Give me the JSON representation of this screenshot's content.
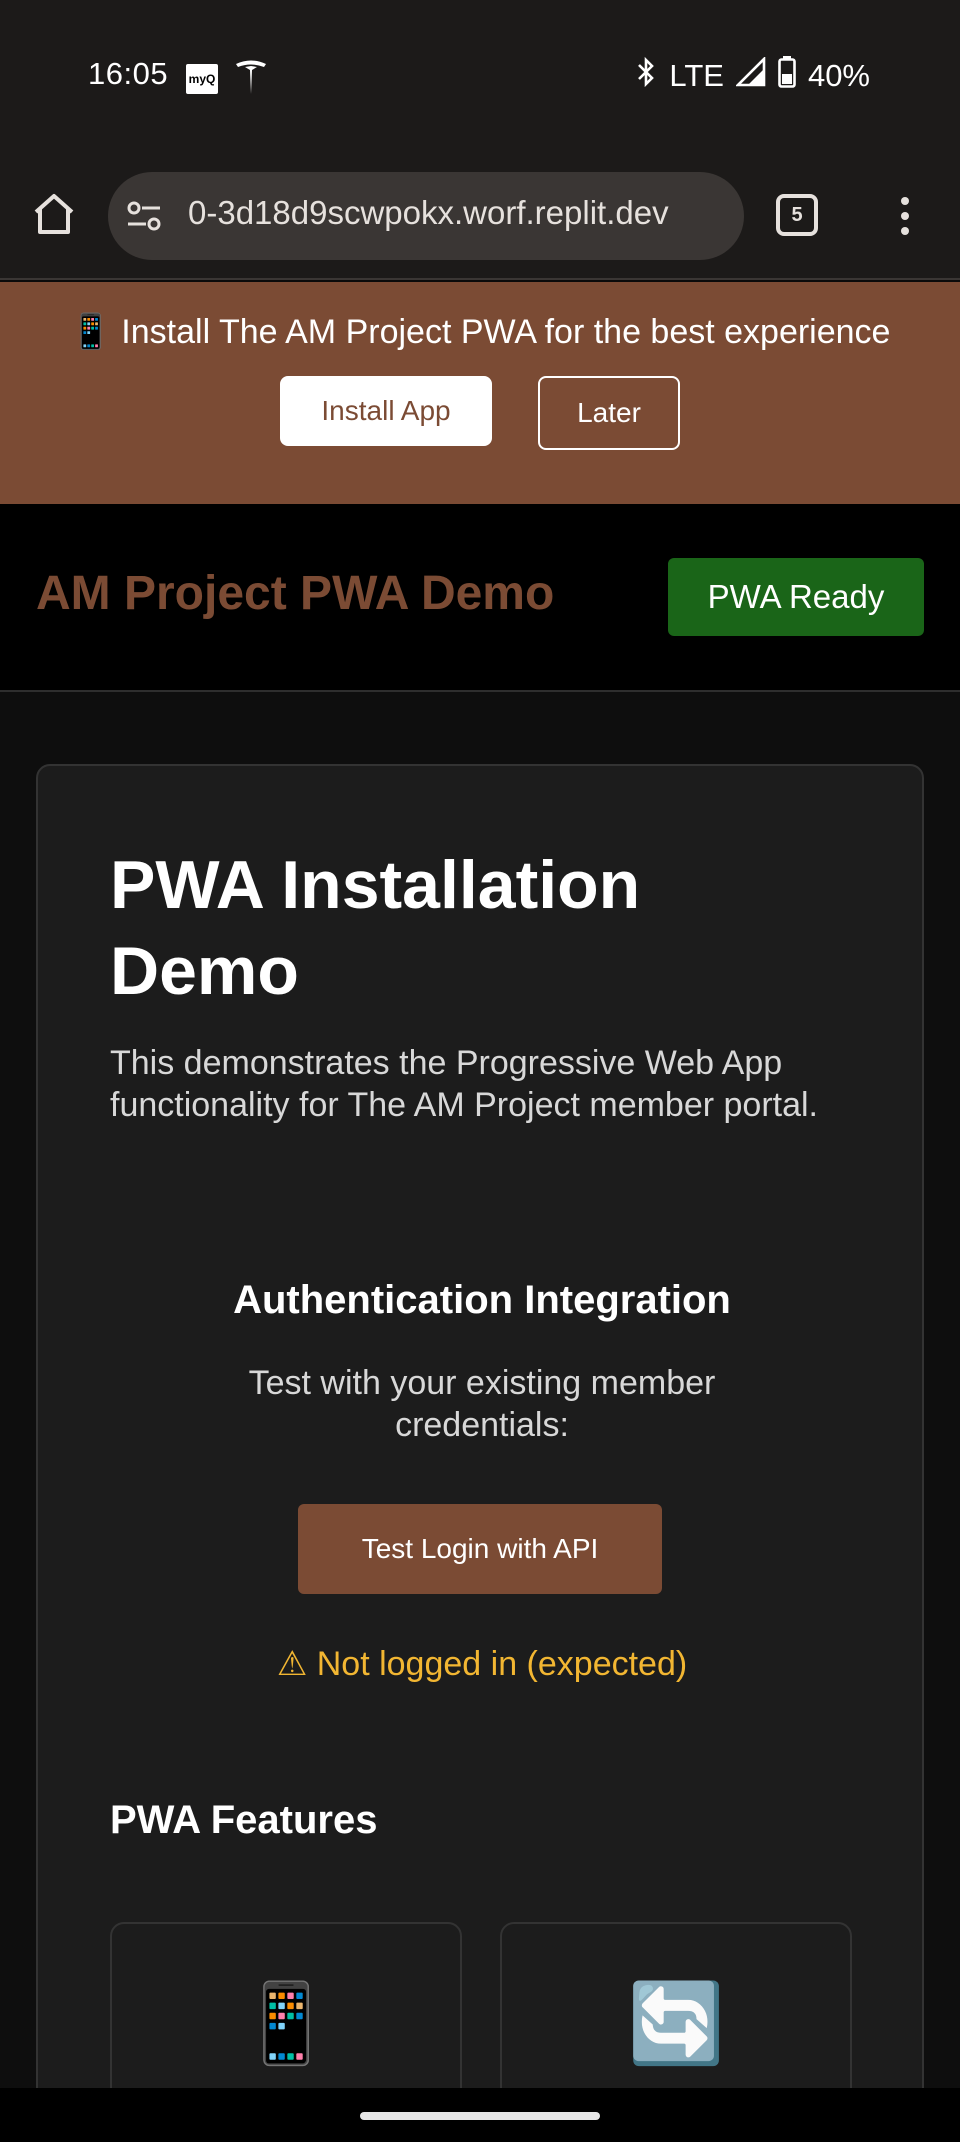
{
  "status_bar": {
    "time": "16:05",
    "myq_label": "myQ",
    "network": "LTE",
    "battery": "40%"
  },
  "browser": {
    "url": "0-3d18d9scwpokx.worf.replit.dev",
    "tab_count": "5"
  },
  "install_banner": {
    "text": "📱 Install The AM Project PWA for the best experience",
    "install_label": "Install App",
    "later_label": "Later"
  },
  "header": {
    "title": "AM Project PWA Demo",
    "badge": "PWA Ready"
  },
  "card": {
    "title": "PWA Installation Demo",
    "description": "This demonstrates the Progressive Web App functionality for The AM Project member portal.",
    "auth_title": "Authentication Integration",
    "auth_desc": "Test with your existing member credentials:",
    "login_label": "Test Login with API",
    "login_status": "⚠ Not logged in (expected)",
    "features_title": "PWA Features",
    "features": [
      {
        "icon": "📱"
      },
      {
        "icon": "🔄"
      }
    ]
  },
  "colors": {
    "brand": "#7b4b34",
    "success": "#1a6518",
    "warning": "#f2b632"
  }
}
